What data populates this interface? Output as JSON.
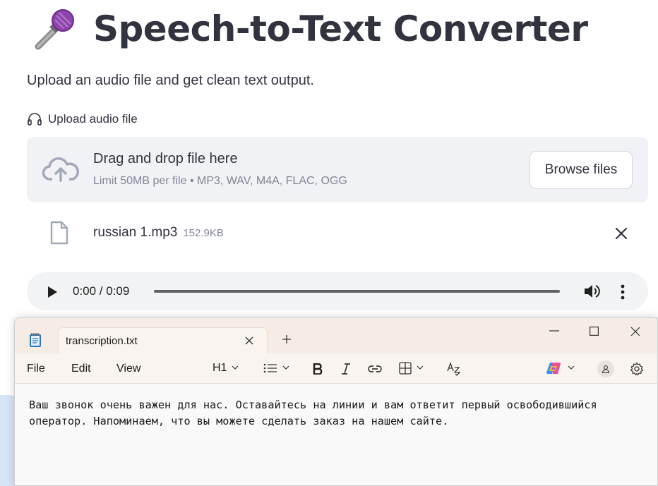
{
  "header": {
    "title": "Speech-to-Text Converter",
    "subtitle": "Upload an audio file and get clean text output.",
    "title_icon": "microphone-icon"
  },
  "uploader": {
    "label": "Upload audio file",
    "label_icon": "headphones-icon",
    "drop_title": "Drag and drop file here",
    "drop_subtitle": "Limit 50MB per file • MP3, WAV, M4A, FLAC, OGG",
    "browse_label": "Browse files"
  },
  "file": {
    "name": "russian 1.mp3",
    "size": "152.9KB"
  },
  "audio_player": {
    "time": "0:00 / 0:09",
    "progress": 0
  },
  "notepad": {
    "tab_title": "transcription.txt",
    "menu": [
      "File",
      "Edit",
      "View"
    ],
    "heading_select": "H1",
    "content": "Ваш звонок очень важен для нас. Оставайтесь на линии и вам ответит первый освободившийся\nоператор. Напоминаем, что вы можете сделать заказ на нашем сайте."
  },
  "colors": {
    "text": "#31333f",
    "muted": "#808495",
    "dropzone_bg": "#f0f2f6",
    "notepad_titlebar": "#f6ece6"
  }
}
